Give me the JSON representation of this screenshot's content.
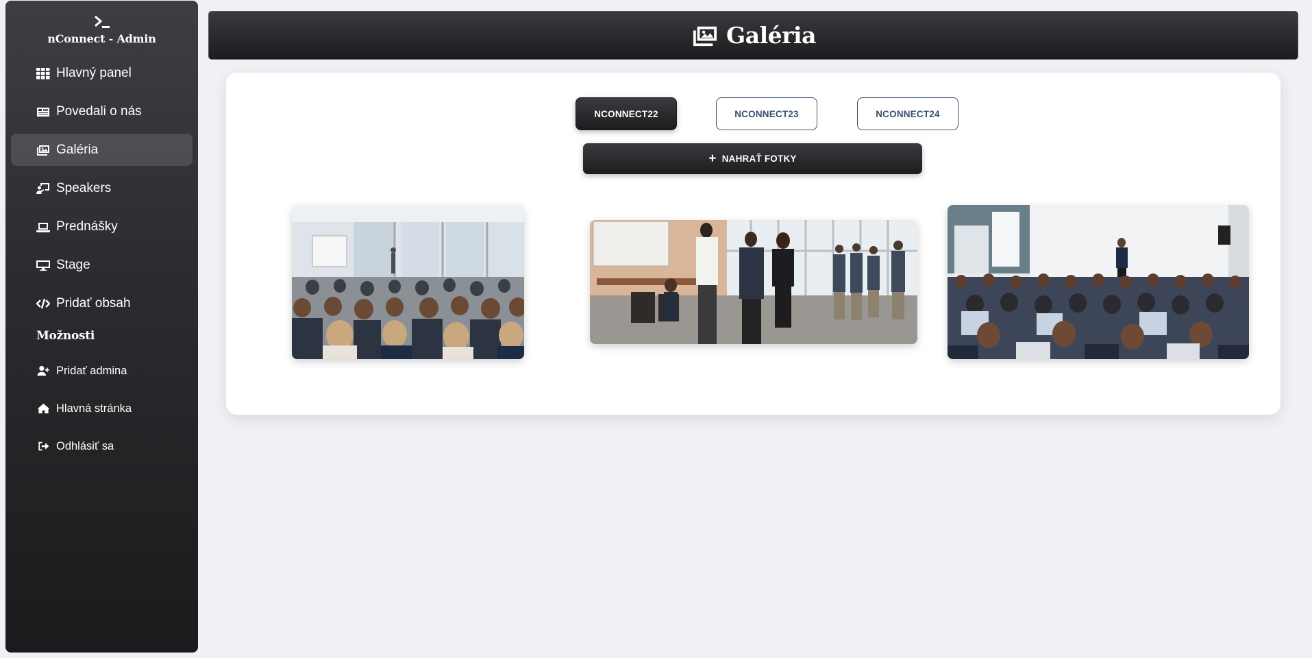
{
  "sidebar": {
    "brand_title": "nConnect - Admin",
    "items": [
      {
        "label": "Hlavný panel",
        "icon": "grid-icon"
      },
      {
        "label": "Povedali o nás",
        "icon": "newspaper-icon"
      },
      {
        "label": "Galéria",
        "icon": "images-icon",
        "active": true
      },
      {
        "label": "Speakers",
        "icon": "chalkboard-teacher-icon"
      },
      {
        "label": "Prednášky",
        "icon": "laptop-icon"
      },
      {
        "label": "Stage",
        "icon": "desktop-icon"
      },
      {
        "label": "Pridať obsah",
        "icon": "code-icon"
      }
    ],
    "section_title": "Možnosti",
    "options": [
      {
        "label": "Pridať admina",
        "icon": "user-plus-icon"
      },
      {
        "label": "Hlavná stránka",
        "icon": "home-icon"
      },
      {
        "label": "Odhlásiť sa",
        "icon": "sign-out-icon"
      }
    ]
  },
  "header": {
    "title": "Galéria",
    "icon": "images-icon"
  },
  "gallery": {
    "tabs": [
      {
        "label": "NCONNECT22",
        "active": true
      },
      {
        "label": "NCONNECT23",
        "active": false
      },
      {
        "label": "NCONNECT24",
        "active": false
      }
    ],
    "upload_label": "NAHRAŤ FOTKY",
    "upload_icon": "plus-icon",
    "photos": [
      {
        "description": "audience-seminar-room"
      },
      {
        "description": "business-people-networking"
      },
      {
        "description": "conference-speaker-stage"
      }
    ]
  },
  "colors": {
    "sidebar_dark": "#1b1b1d",
    "accent_outline": "#3b4e6d",
    "background": "#f0f1f5"
  }
}
